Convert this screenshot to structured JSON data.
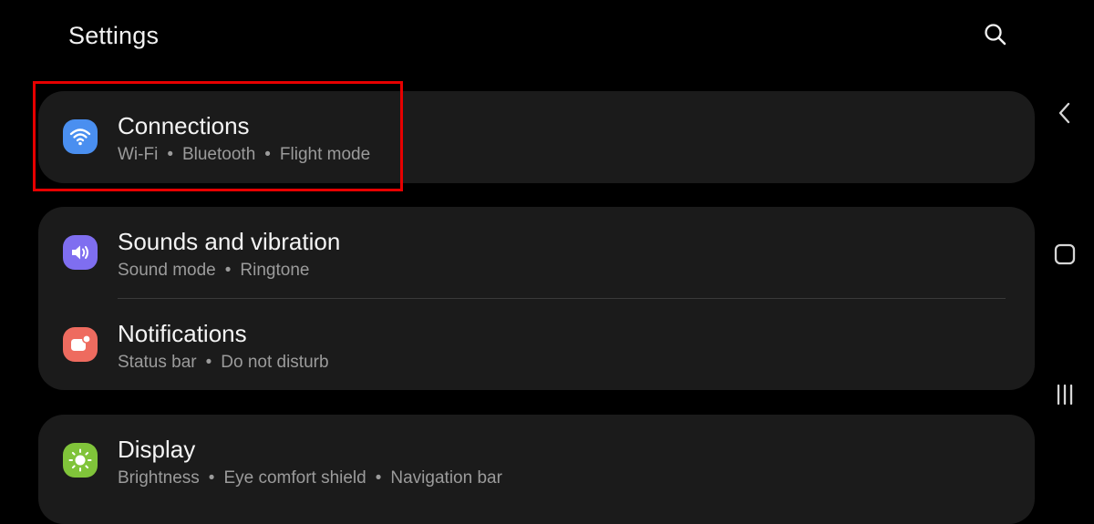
{
  "header": {
    "title": "Settings",
    "search_icon": "search-icon"
  },
  "cards": [
    {
      "rows": [
        {
          "title": "Connections",
          "subtitle_parts": [
            "Wi-Fi",
            "Bluetooth",
            "Flight mode"
          ],
          "icon": "wifi-icon",
          "icon_color": "#4a8ff0"
        }
      ]
    },
    {
      "rows": [
        {
          "title": "Sounds and vibration",
          "subtitle_parts": [
            "Sound mode",
            "Ringtone"
          ],
          "icon": "speaker-icon",
          "icon_color": "#7f6ef0"
        },
        {
          "title": "Notifications",
          "subtitle_parts": [
            "Status bar",
            "Do not disturb"
          ],
          "icon": "notification-icon",
          "icon_color": "#ee6b5f"
        }
      ]
    },
    {
      "rows": [
        {
          "title": "Display",
          "subtitle_parts": [
            "Brightness",
            "Eye comfort shield",
            "Navigation bar"
          ],
          "icon": "sun-icon",
          "icon_color": "#80c43a"
        }
      ]
    }
  ],
  "separator": "•",
  "highlight_color": "#e60000",
  "nav_bar": {
    "back_icon": "back-chevron-icon",
    "home_icon": "home-square-icon",
    "recents_icon": "recents-lines-icon"
  }
}
